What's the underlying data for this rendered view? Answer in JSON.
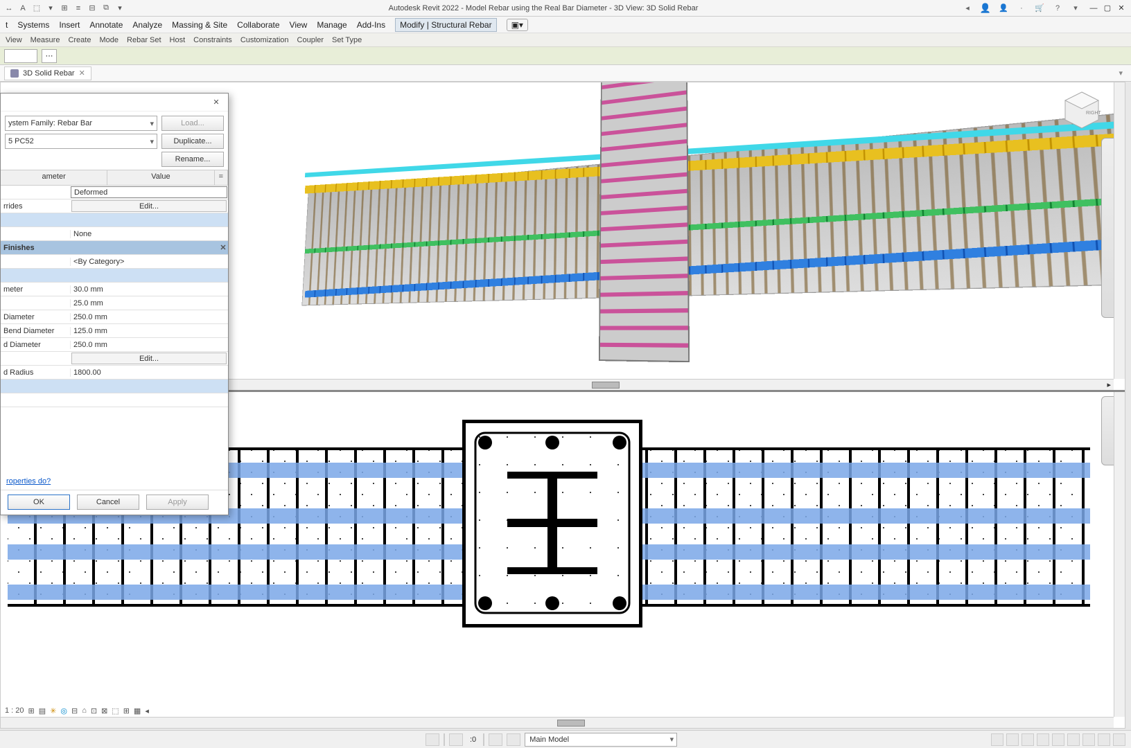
{
  "app": {
    "title": "Autodesk Revit 2022 - Model Rebar using the Real Bar Diameter - 3D View: 3D Solid Rebar"
  },
  "menu": {
    "items": [
      "t",
      "Systems",
      "Insert",
      "Annotate",
      "Analyze",
      "Massing & Site",
      "Collaborate",
      "View",
      "Manage",
      "Add-Ins",
      "Modify | Structural Rebar"
    ]
  },
  "ribbon_panels": [
    "View",
    "Measure",
    "Create",
    "Mode",
    "Rebar Set",
    "Host",
    "Constraints",
    "Customization",
    "Coupler",
    "Set Type"
  ],
  "view_tab": {
    "label": "3D Solid Rebar"
  },
  "dialog": {
    "family_label": "ystem Family: Rebar Bar",
    "type_label": "5 PC52",
    "buttons": {
      "load": "Load...",
      "duplicate": "Duplicate...",
      "rename": "Rename...",
      "edit": "Edit..."
    },
    "headers": {
      "parameter": "ameter",
      "value": "Value"
    },
    "rows": [
      {
        "param": "",
        "val": "Deformed",
        "boxed": true
      },
      {
        "param": "rrides",
        "val": "Edit...",
        "btn": true
      },
      {
        "param": "",
        "val": "",
        "hl": true
      },
      {
        "param": "",
        "val": "None"
      },
      {
        "section": "Finishes"
      },
      {
        "param": "",
        "val": "<By Category>"
      },
      {
        "param": "",
        "val": "",
        "hl": true
      },
      {
        "param": "meter",
        "val": "30.0 mm"
      },
      {
        "param": "",
        "val": "25.0 mm"
      },
      {
        "param": "Diameter",
        "val": "250.0 mm"
      },
      {
        "param": " Bend Diameter",
        "val": "125.0 mm"
      },
      {
        "param": "d Diameter",
        "val": "250.0 mm"
      },
      {
        "param": "",
        "val": "Edit...",
        "btn": true
      },
      {
        "param": "d Radius",
        "val": "1800.00"
      },
      {
        "param": "",
        "val": "",
        "hl": true
      },
      {
        "param": "",
        "val": ""
      }
    ],
    "help_link": "roperties do?",
    "footer": {
      "ok": "OK",
      "cancel": "Cancel",
      "apply": "Apply"
    }
  },
  "view_controls": {
    "scale": "1 : 20"
  },
  "status": {
    "zero_field": ":0",
    "main_model": "Main Model"
  }
}
